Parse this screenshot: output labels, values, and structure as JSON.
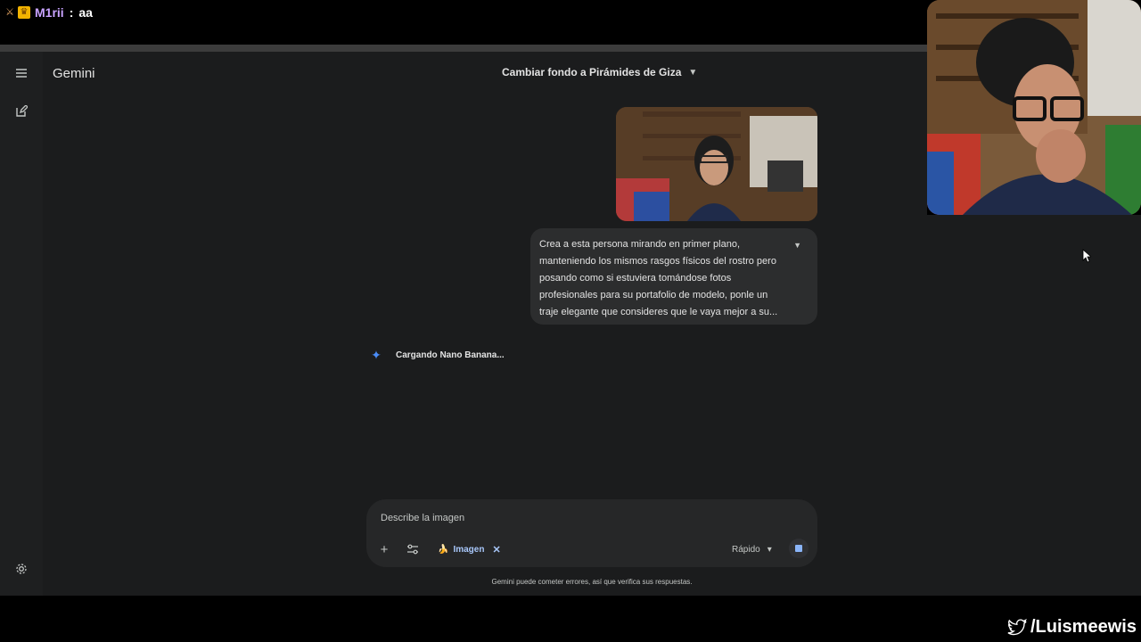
{
  "stream_chat": {
    "user": "M1rii",
    "separator": ":",
    "message": "aa"
  },
  "app": {
    "brand": "Gemini",
    "chat_title": "Cambiar fondo a Pirámides de Giza",
    "sidebar": {
      "menu_icon": "menu-icon",
      "new_chat_icon": "edit-icon",
      "settings_icon": "gear-icon"
    }
  },
  "conversation": {
    "user_prompt_lines": [
      "Crea a esta persona mirando en primer plano,",
      "manteniendo los mismos rasgos físicos del rostro pero",
      "posando como si estuviera tomándose fotos",
      "profesionales para su portafolio de modelo, ponle un",
      "traje elegante que consideres que le vaya mejor a su..."
    ],
    "loading_text": "Cargando Nano Banana..."
  },
  "composer": {
    "placeholder": "Describe la imagen",
    "chip_label": "Imagen",
    "chip_emoji": "🍌",
    "model_label": "Rápido"
  },
  "footer": {
    "disclaimer": "Gemini puede cometer errores, así que verifica sus respuestas."
  },
  "overlay": {
    "twitter_handle": "/Luismeewis"
  },
  "colors": {
    "app_bg": "#1b1c1d",
    "bubble_bg": "#2c2d2e",
    "accent": "#a8c7fa",
    "sparkle": "#4a8cf7"
  }
}
